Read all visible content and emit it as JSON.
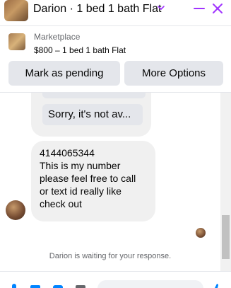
{
  "header": {
    "title": "Darion · 1 bed 1 bath Flat",
    "accent_color": "#a033ff",
    "icons": [
      "chevron-down-icon",
      "minimize-icon",
      "close-icon"
    ]
  },
  "listing": {
    "kicker": "Marketplace",
    "summary": "$800 – 1 bed 1 bath Flat"
  },
  "actions": {
    "mark_pending": "Mark as pending",
    "more_options": "More Options"
  },
  "thread": {
    "quick_reply": "Sorry, it's not av...",
    "message_lines": [
      "4144065344",
      "This is my number",
      "please feel free to call",
      "or text id really like",
      "check out"
    ],
    "waiting_text": "Darion is waiting for your response."
  }
}
